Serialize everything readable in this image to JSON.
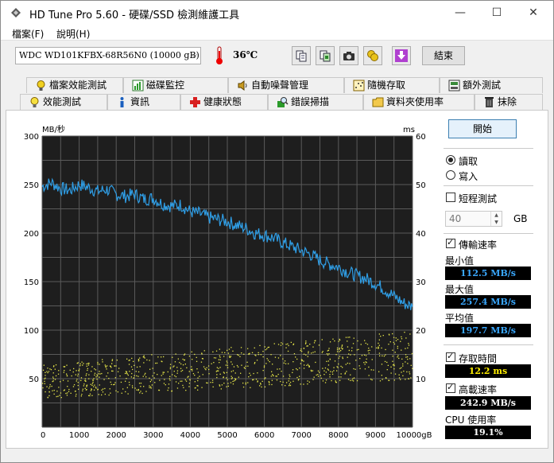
{
  "window": {
    "title": "HD Tune Pro 5.60 - 硬碟/SSD 檢測維護工具",
    "minimize": "—",
    "maximize": "☐",
    "close": "✕"
  },
  "menu": {
    "items": [
      {
        "label": "檔案(F)"
      },
      {
        "label": "說明(H)"
      }
    ]
  },
  "toolbar": {
    "drive": "WDC WD101KFBX-68R56N0 (10000 gB)",
    "temperature": "36℃",
    "buttons": [
      "copy-text-icon",
      "copy-screenshot-icon",
      "camera-icon",
      "coins-icon",
      "download-arrow-icon"
    ],
    "exit_label": "結束"
  },
  "tabs": {
    "top": [
      {
        "label": "檔案效能測試",
        "icon": "file-benchmark-icon"
      },
      {
        "label": "磁碟監控",
        "icon": "disk-monitor-icon"
      },
      {
        "label": "自動噪聲管理",
        "icon": "speaker-icon"
      },
      {
        "label": "隨機存取",
        "icon": "random-access-icon"
      },
      {
        "label": "額外測試",
        "icon": "extra-tests-icon"
      }
    ],
    "bottom": [
      {
        "label": "效能測試",
        "icon": "lightbulb-icon",
        "active": true
      },
      {
        "label": "資訊",
        "icon": "info-icon"
      },
      {
        "label": "健康狀態",
        "icon": "health-cross-icon"
      },
      {
        "label": "錯誤掃描",
        "icon": "magnifier-icon"
      },
      {
        "label": "資料夾使用率",
        "icon": "folder-icon"
      },
      {
        "label": "抹除",
        "icon": "trash-icon"
      }
    ]
  },
  "controls": {
    "start_label": "開始",
    "read_label": "讀取",
    "write_label": "寫入",
    "short_test_label": "短程測試",
    "short_test_value": "40",
    "short_test_unit": "GB",
    "transfer_rate_label": "傳輸速率",
    "min_label": "最小值",
    "min_value": "112.5 MB/s",
    "max_label": "最大值",
    "max_value": "257.4 MB/s",
    "avg_label": "平均值",
    "avg_value": "197.7 MB/s",
    "access_time_label": "存取時間",
    "access_time_value": "12.2 ms",
    "burst_rate_label": "高載速率",
    "burst_rate_value": "242.9 MB/s",
    "cpu_label": "CPU 使用率",
    "cpu_value": "19.1%"
  },
  "chart_data": {
    "type": "line",
    "ylabel_left": "MB/秒",
    "ylabel_right": "ms",
    "y_left_ticks": [
      "300",
      "250",
      "200",
      "150",
      "100",
      "50"
    ],
    "y_right_ticks": [
      "60",
      "50",
      "40",
      "30",
      "20",
      "10"
    ],
    "x_ticks": [
      "0",
      "1000",
      "2000",
      "3000",
      "4000",
      "5000",
      "6000",
      "7000",
      "8000",
      "9000",
      "10000gB"
    ],
    "xlim": [
      0,
      10000
    ],
    "ylim_left": [
      0,
      300
    ],
    "ylim_right": [
      0,
      60
    ],
    "grid": true,
    "colors": {
      "background": "#1e1e1e",
      "grid": "#5a5a5a",
      "transfer": "#2f9ee6",
      "access": "#e8e84a"
    },
    "series": [
      {
        "kind": "transfer_rate",
        "x": [
          0,
          250,
          500,
          750,
          1000,
          1250,
          1500,
          1750,
          2000,
          2250,
          2500,
          2750,
          3000,
          3250,
          3500,
          3750,
          4000,
          4250,
          4500,
          4750,
          5000,
          5250,
          5500,
          5750,
          6000,
          6250,
          6500,
          6750,
          7000,
          7250,
          7500,
          7750,
          8000,
          8250,
          8500,
          8750,
          9000,
          9250,
          9500,
          9750,
          10000
        ],
        "values": [
          248,
          252,
          246,
          244,
          250,
          247,
          243,
          245,
          240,
          238,
          240,
          235,
          236,
          230,
          228,
          229,
          222,
          220,
          216,
          214,
          212,
          208,
          205,
          200,
          198,
          195,
          190,
          186,
          182,
          178,
          172,
          168,
          165,
          160,
          156,
          153,
          148,
          142,
          135,
          128,
          124
        ]
      },
      {
        "kind": "access_time",
        "x_range": [
          0,
          10000
        ],
        "ms_min_start": 6,
        "ms_max_start": 13,
        "ms_min_end": 10,
        "ms_max_end": 20,
        "points": 900
      }
    ]
  }
}
